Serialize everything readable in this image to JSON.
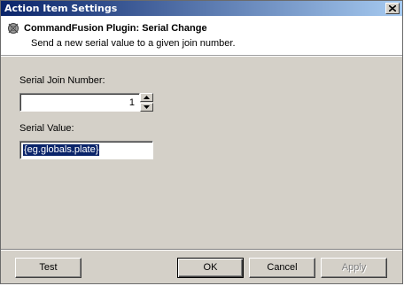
{
  "window": {
    "title": "Action Item Settings"
  },
  "header": {
    "title": "CommandFusion Plugin: Serial Change",
    "subtitle": "Send a new serial value to a given join number.",
    "icon": "plugin-gear-icon"
  },
  "form": {
    "join_label": "Serial Join Number:",
    "join_value": "1",
    "serial_label": "Serial Value:",
    "serial_value": "{eg.globals.plate}"
  },
  "footer": {
    "test_label": "Test",
    "ok_label": "OK",
    "cancel_label": "Cancel",
    "apply_label": "Apply"
  },
  "colors": {
    "titlebar_start": "#0a246a",
    "titlebar_end": "#a6caf0",
    "dialog_bg": "#d4d0c8",
    "selection": "#0a246a"
  }
}
